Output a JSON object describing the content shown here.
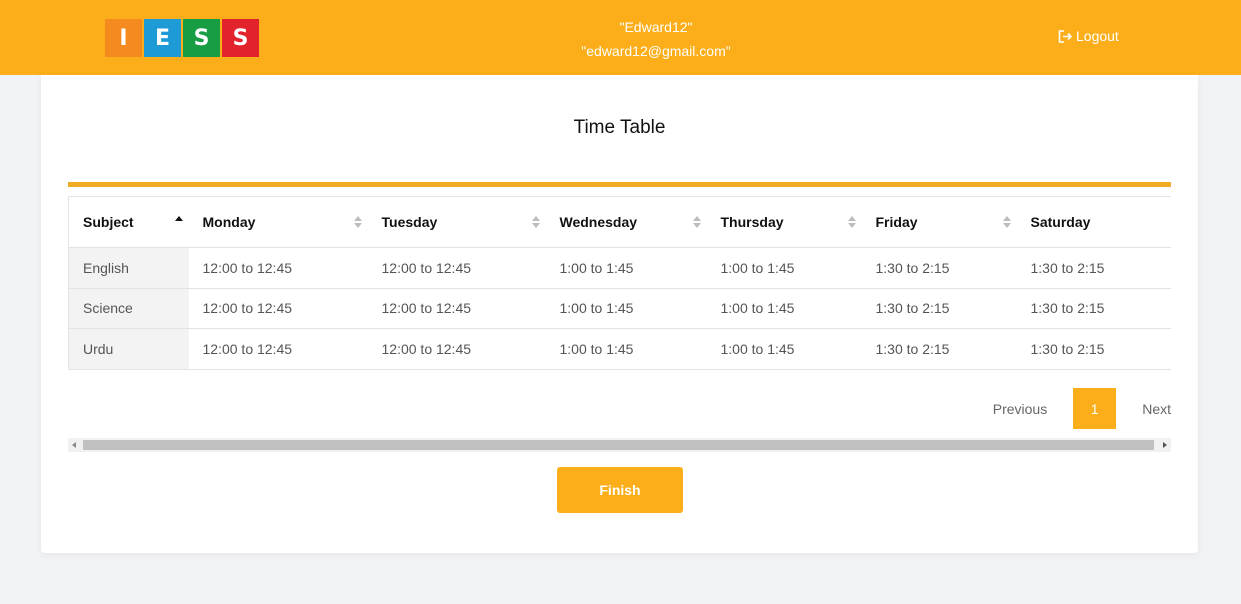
{
  "header": {
    "logo": [
      {
        "letter": "I",
        "color": "#f58b1f"
      },
      {
        "letter": "E",
        "color": "#1e9ad6"
      },
      {
        "letter": "S",
        "color": "#189c44"
      },
      {
        "letter": "S",
        "color": "#e3232c"
      }
    ],
    "username": "\"Edward12\"",
    "email": "\"edward12@gmail.com\"",
    "logout_label": "Logout",
    "bg_color": "#fbae19"
  },
  "main": {
    "title": "Time Table",
    "table": {
      "columns": [
        "Subject",
        "Monday",
        "Tuesday",
        "Wednesday",
        "Thursday",
        "Friday",
        "Saturday"
      ],
      "sorted_column": "Subject",
      "rows": [
        [
          "English",
          "12:00 to 12:45",
          "12:00 to 12:45",
          "1:00 to 1:45",
          "1:00 to 1:45",
          "1:30 to 2:15",
          "1:30 to 2:15"
        ],
        [
          "Science",
          "12:00 to 12:45",
          "12:00 to 12:45",
          "1:00 to 1:45",
          "1:00 to 1:45",
          "1:30 to 2:15",
          "1:30 to 2:15"
        ],
        [
          "Urdu",
          "12:00 to 12:45",
          "12:00 to 12:45",
          "1:00 to 1:45",
          "1:00 to 1:45",
          "1:30 to 2:15",
          "1:30 to 2:15"
        ]
      ]
    },
    "pagination": {
      "previous_label": "Previous",
      "current_page": "1",
      "next_label": "Next"
    },
    "finish_label": "Finish"
  }
}
